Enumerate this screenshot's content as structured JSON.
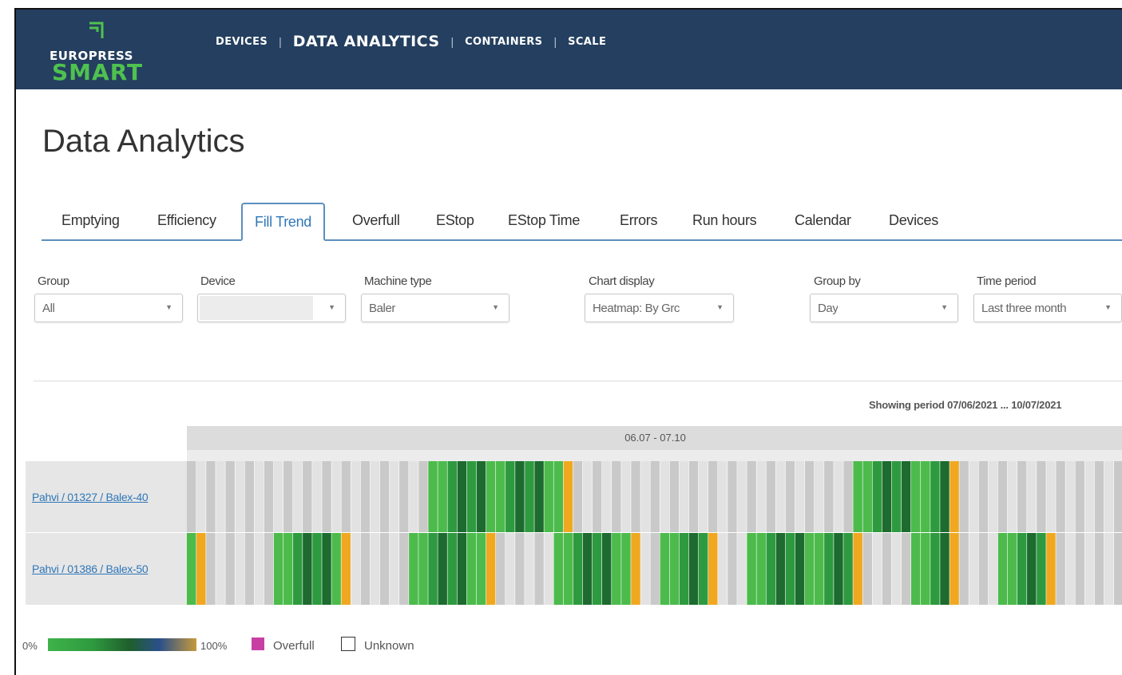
{
  "brand": {
    "top": "EUROPRESS",
    "bottom": "SMART",
    "header_color": "#243f5f",
    "accent_green": "#4fc14f"
  },
  "nav": {
    "devices": "DEVICES",
    "data_analytics": "DATA ANALYTICS",
    "containers": "CONTAINERS",
    "scale": "SCALE"
  },
  "page": {
    "title": "Data Analytics"
  },
  "tabs": [
    {
      "label": "Emptying"
    },
    {
      "label": "Efficiency"
    },
    {
      "label": "Fill Trend",
      "active": true
    },
    {
      "label": "Overfull"
    },
    {
      "label": "EStop"
    },
    {
      "label": "EStop Time"
    },
    {
      "label": "Errors"
    },
    {
      "label": "Run hours"
    },
    {
      "label": "Calendar"
    },
    {
      "label": "Devices"
    }
  ],
  "filters": {
    "group": {
      "label": "Group",
      "value": "All"
    },
    "device": {
      "label": "Device",
      "value": ""
    },
    "machine_type": {
      "label": "Machine type",
      "value": "Baler"
    },
    "chart_display": {
      "label": "Chart display",
      "value": "Heatmap: By Grc"
    },
    "group_by": {
      "label": "Group by",
      "value": "Day"
    },
    "time_period": {
      "label": "Time period",
      "value": "Last three month"
    }
  },
  "period_text": "Showing period 07/06/2021 ... 10/07/2021",
  "chart_data": {
    "type": "heatmap",
    "column_header": "06.07 - 07.10",
    "num_columns": 97,
    "rows": [
      {
        "label": "Pahvi / 01327 / Balex-40",
        "filled_runs": [
          [
            25,
            39
          ]
        ],
        "filled_runs_b": [
          [
            69,
            79
          ]
        ]
      },
      {
        "label": "Pahvi / 01386 / Balex-50",
        "filled_runs": [
          [
            0,
            1
          ],
          [
            9,
            16
          ],
          [
            23,
            31
          ],
          [
            38,
            46
          ],
          [
            49,
            54
          ],
          [
            58,
            69
          ],
          [
            75,
            79
          ],
          [
            84,
            89
          ]
        ]
      }
    ],
    "colors": {
      "empty": "#c9c9c9",
      "empty_alt": "#e2e2e2",
      "light_green": "#4cbb4c",
      "mid_green": "#2e9a3f",
      "dark_green": "#1d6b2f",
      "orange": "#f0a820"
    },
    "legend": {
      "min_label": "0%",
      "max_label": "100%",
      "overfull_label": "Overfull",
      "overfull_color": "#c83fa4",
      "unknown_label": "Unknown"
    }
  }
}
